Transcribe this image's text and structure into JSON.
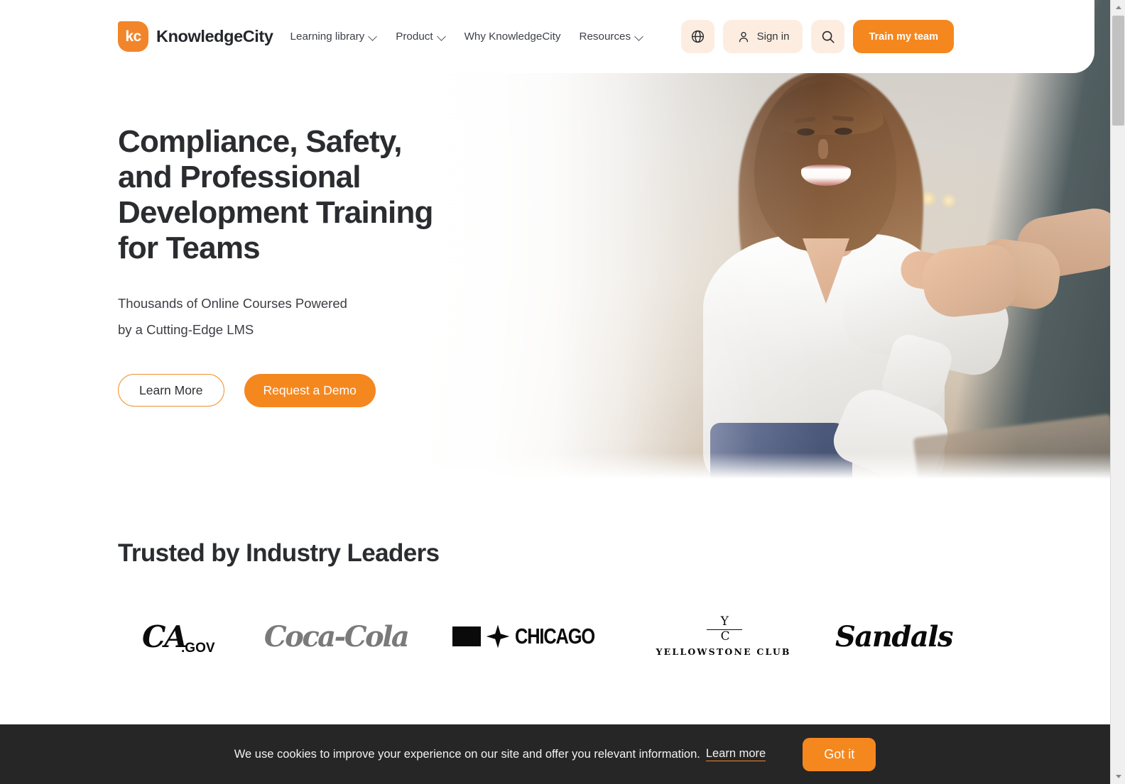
{
  "header": {
    "brand": {
      "mark": "kc",
      "name": "KnowledgeCity",
      "mark_icon": "kc-logo-icon"
    },
    "nav": [
      {
        "label": "Learning library",
        "has_chevron": true
      },
      {
        "label": "Product",
        "has_chevron": true
      },
      {
        "label": "Why KnowledgeCity",
        "has_chevron": false
      },
      {
        "label": "Resources",
        "has_chevron": true
      }
    ],
    "actions": {
      "language_icon": "globe-icon",
      "signin_icon": "user-icon",
      "signin_label": "Sign in",
      "search_icon": "search-icon",
      "train_label": "Train my team"
    }
  },
  "hero": {
    "title": "Compliance, Safety,\nand Professional\nDevelopment Training\nfor Teams",
    "subtitle": "Thousands of Online Courses Powered\nby a Cutting-Edge LMS",
    "primary_cta": "Request a Demo",
    "secondary_cta": "Learn More",
    "image_alt": "businesswoman-handshake-photo"
  },
  "trusted": {
    "title": "Trusted by Industry Leaders",
    "logos": [
      {
        "name": "ca-gov-logo",
        "text": "CA",
        "suffix": ".GOV"
      },
      {
        "name": "coca-cola-logo",
        "text": "Coca-Cola"
      },
      {
        "name": "chicago-logo",
        "text": "CHICAGO"
      },
      {
        "name": "yellowstone-club-logo",
        "text": "YELLOWSTONE CLUB",
        "mark_top": "Y",
        "mark_bottom": "C"
      },
      {
        "name": "sandals-logo",
        "text": "Sandals"
      }
    ]
  },
  "cookie": {
    "message": "We use cookies to improve your experience on our site and offer you relevant information.",
    "link": "Learn more",
    "accept": "Got it"
  },
  "colors": {
    "brand_orange": "#F5871F",
    "pill_peach": "#FDEDE1",
    "ink": "#2B2C30",
    "cookie_bg": "#262626"
  }
}
